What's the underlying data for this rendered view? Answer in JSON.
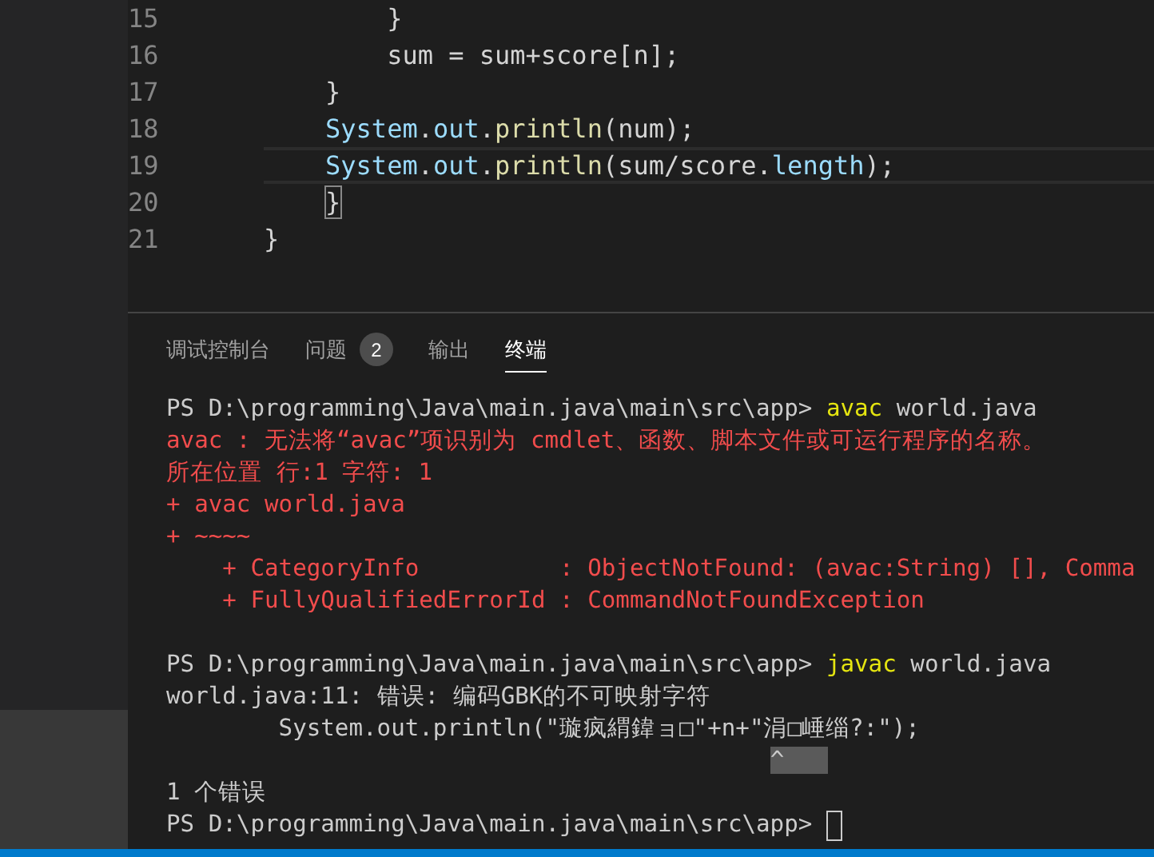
{
  "editor": {
    "lines": [
      {
        "number": "15",
        "current": false,
        "segments": [
          {
            "kind": "plain",
            "text": "        }"
          }
        ]
      },
      {
        "number": "16",
        "current": false,
        "segments": [
          {
            "kind": "plain",
            "text": "        sum = sum+score[n];"
          }
        ]
      },
      {
        "number": "17",
        "current": false,
        "segments": [
          {
            "kind": "plain",
            "text": "    }"
          }
        ]
      },
      {
        "number": "18",
        "current": false,
        "segments": [
          {
            "kind": "var",
            "text": "    System"
          },
          {
            "kind": "plain",
            "text": "."
          },
          {
            "kind": "var",
            "text": "out"
          },
          {
            "kind": "plain",
            "text": "."
          },
          {
            "kind": "func",
            "text": "println"
          },
          {
            "kind": "plain",
            "text": "(num);"
          }
        ]
      },
      {
        "number": "19",
        "current": true,
        "segments": [
          {
            "kind": "var",
            "text": "    System"
          },
          {
            "kind": "plain",
            "text": "."
          },
          {
            "kind": "var",
            "text": "out"
          },
          {
            "kind": "plain",
            "text": "."
          },
          {
            "kind": "func",
            "text": "println"
          },
          {
            "kind": "plain",
            "text": "(sum/score."
          },
          {
            "kind": "var",
            "text": "length"
          },
          {
            "kind": "plain",
            "text": ");"
          }
        ]
      },
      {
        "number": "20",
        "current": false,
        "segments": [
          {
            "kind": "bracket",
            "text": "    }"
          }
        ]
      },
      {
        "number": "21",
        "current": false,
        "segments": [
          {
            "kind": "plain",
            "text": "}"
          }
        ]
      }
    ]
  },
  "panel": {
    "tabs": [
      {
        "label": "调试控制台",
        "selected": false
      },
      {
        "label": "问题",
        "selected": false,
        "badge": "2"
      },
      {
        "label": "输出",
        "selected": false
      },
      {
        "label": "终端",
        "selected": true
      }
    ],
    "terminal": [
      [
        {
          "segments": [
            {
              "kind": "plain",
              "text": "PS D:\\programming\\Java\\main.java\\main\\src\\app> "
            },
            {
              "kind": "command",
              "text": "avac"
            },
            {
              "kind": "plain",
              "text": " world.java"
            }
          ]
        },
        {
          "segments": [
            {
              "kind": "error",
              "text": "avac : 无法将“avac”项识别为 cmdlet、函数、脚本文件或可运行程序的名称。"
            }
          ]
        },
        {
          "segments": [
            {
              "kind": "error",
              "text": "所在位置 行:1 字符: 1"
            }
          ]
        },
        {
          "segments": [
            {
              "kind": "error",
              "text": "+ avac world.java"
            }
          ]
        },
        {
          "segments": [
            {
              "kind": "error",
              "text": "+ ~~~~"
            }
          ]
        },
        {
          "segments": [
            {
              "kind": "error",
              "text": "    + CategoryInfo          : ObjectNotFound: (avac:String) [], Comma"
            }
          ]
        },
        {
          "segments": [
            {
              "kind": "error",
              "text": "    + FullyQualifiedErrorId : CommandNotFoundException"
            }
          ]
        }
      ],
      [
        {
          "segments": [
            {
              "kind": "plain",
              "text": "PS D:\\programming\\Java\\main.java\\main\\src\\app> "
            },
            {
              "kind": "command",
              "text": "javac"
            },
            {
              "kind": "plain",
              "text": " world.java"
            }
          ]
        },
        {
          "segments": [
            {
              "kind": "plain",
              "text": "world.java:11: 错误: 编码GBK的不可映射字符"
            }
          ]
        },
        {
          "segments": [
            {
              "kind": "plain",
              "text": "        System.out.println(\"璇疯緭鍏ョ□\"+n+\"涓□崜缁?:\");"
            }
          ]
        },
        {
          "segments": [
            {
              "kind": "marker",
              "text": "                                           ^"
            }
          ]
        },
        {
          "segments": [
            {
              "kind": "plain",
              "text": "1 个错误"
            }
          ]
        },
        {
          "segments": [
            {
              "kind": "plain",
              "text": "PS D:\\programming\\Java\\main.java\\main\\src\\app>"
            }
          ],
          "cursor": true
        }
      ]
    ]
  }
}
